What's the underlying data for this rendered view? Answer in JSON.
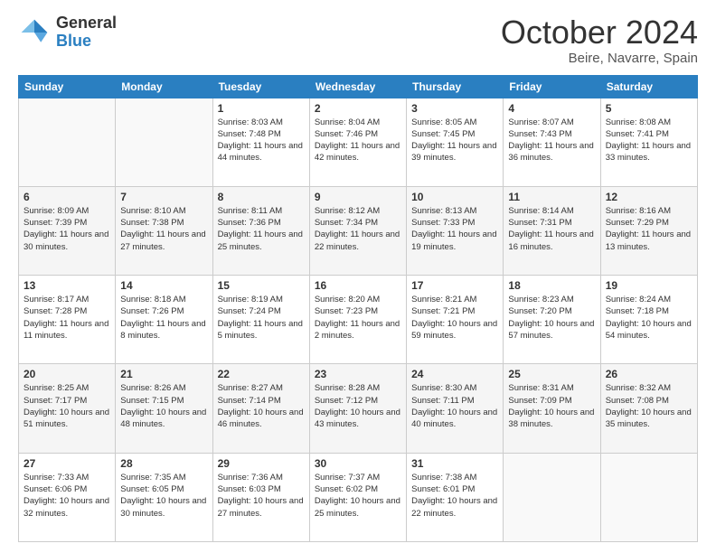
{
  "logo": {
    "general": "General",
    "blue": "Blue"
  },
  "header": {
    "month": "October 2024",
    "location": "Beire, Navarre, Spain"
  },
  "weekdays": [
    "Sunday",
    "Monday",
    "Tuesday",
    "Wednesday",
    "Thursday",
    "Friday",
    "Saturday"
  ],
  "weeks": [
    [
      {
        "date": "",
        "sunrise": "",
        "sunset": "",
        "daylight": ""
      },
      {
        "date": "",
        "sunrise": "",
        "sunset": "",
        "daylight": ""
      },
      {
        "date": "1",
        "sunrise": "Sunrise: 8:03 AM",
        "sunset": "Sunset: 7:48 PM",
        "daylight": "Daylight: 11 hours and 44 minutes."
      },
      {
        "date": "2",
        "sunrise": "Sunrise: 8:04 AM",
        "sunset": "Sunset: 7:46 PM",
        "daylight": "Daylight: 11 hours and 42 minutes."
      },
      {
        "date": "3",
        "sunrise": "Sunrise: 8:05 AM",
        "sunset": "Sunset: 7:45 PM",
        "daylight": "Daylight: 11 hours and 39 minutes."
      },
      {
        "date": "4",
        "sunrise": "Sunrise: 8:07 AM",
        "sunset": "Sunset: 7:43 PM",
        "daylight": "Daylight: 11 hours and 36 minutes."
      },
      {
        "date": "5",
        "sunrise": "Sunrise: 8:08 AM",
        "sunset": "Sunset: 7:41 PM",
        "daylight": "Daylight: 11 hours and 33 minutes."
      }
    ],
    [
      {
        "date": "6",
        "sunrise": "Sunrise: 8:09 AM",
        "sunset": "Sunset: 7:39 PM",
        "daylight": "Daylight: 11 hours and 30 minutes."
      },
      {
        "date": "7",
        "sunrise": "Sunrise: 8:10 AM",
        "sunset": "Sunset: 7:38 PM",
        "daylight": "Daylight: 11 hours and 27 minutes."
      },
      {
        "date": "8",
        "sunrise": "Sunrise: 8:11 AM",
        "sunset": "Sunset: 7:36 PM",
        "daylight": "Daylight: 11 hours and 25 minutes."
      },
      {
        "date": "9",
        "sunrise": "Sunrise: 8:12 AM",
        "sunset": "Sunset: 7:34 PM",
        "daylight": "Daylight: 11 hours and 22 minutes."
      },
      {
        "date": "10",
        "sunrise": "Sunrise: 8:13 AM",
        "sunset": "Sunset: 7:33 PM",
        "daylight": "Daylight: 11 hours and 19 minutes."
      },
      {
        "date": "11",
        "sunrise": "Sunrise: 8:14 AM",
        "sunset": "Sunset: 7:31 PM",
        "daylight": "Daylight: 11 hours and 16 minutes."
      },
      {
        "date": "12",
        "sunrise": "Sunrise: 8:16 AM",
        "sunset": "Sunset: 7:29 PM",
        "daylight": "Daylight: 11 hours and 13 minutes."
      }
    ],
    [
      {
        "date": "13",
        "sunrise": "Sunrise: 8:17 AM",
        "sunset": "Sunset: 7:28 PM",
        "daylight": "Daylight: 11 hours and 11 minutes."
      },
      {
        "date": "14",
        "sunrise": "Sunrise: 8:18 AM",
        "sunset": "Sunset: 7:26 PM",
        "daylight": "Daylight: 11 hours and 8 minutes."
      },
      {
        "date": "15",
        "sunrise": "Sunrise: 8:19 AM",
        "sunset": "Sunset: 7:24 PM",
        "daylight": "Daylight: 11 hours and 5 minutes."
      },
      {
        "date": "16",
        "sunrise": "Sunrise: 8:20 AM",
        "sunset": "Sunset: 7:23 PM",
        "daylight": "Daylight: 11 hours and 2 minutes."
      },
      {
        "date": "17",
        "sunrise": "Sunrise: 8:21 AM",
        "sunset": "Sunset: 7:21 PM",
        "daylight": "Daylight: 10 hours and 59 minutes."
      },
      {
        "date": "18",
        "sunrise": "Sunrise: 8:23 AM",
        "sunset": "Sunset: 7:20 PM",
        "daylight": "Daylight: 10 hours and 57 minutes."
      },
      {
        "date": "19",
        "sunrise": "Sunrise: 8:24 AM",
        "sunset": "Sunset: 7:18 PM",
        "daylight": "Daylight: 10 hours and 54 minutes."
      }
    ],
    [
      {
        "date": "20",
        "sunrise": "Sunrise: 8:25 AM",
        "sunset": "Sunset: 7:17 PM",
        "daylight": "Daylight: 10 hours and 51 minutes."
      },
      {
        "date": "21",
        "sunrise": "Sunrise: 8:26 AM",
        "sunset": "Sunset: 7:15 PM",
        "daylight": "Daylight: 10 hours and 48 minutes."
      },
      {
        "date": "22",
        "sunrise": "Sunrise: 8:27 AM",
        "sunset": "Sunset: 7:14 PM",
        "daylight": "Daylight: 10 hours and 46 minutes."
      },
      {
        "date": "23",
        "sunrise": "Sunrise: 8:28 AM",
        "sunset": "Sunset: 7:12 PM",
        "daylight": "Daylight: 10 hours and 43 minutes."
      },
      {
        "date": "24",
        "sunrise": "Sunrise: 8:30 AM",
        "sunset": "Sunset: 7:11 PM",
        "daylight": "Daylight: 10 hours and 40 minutes."
      },
      {
        "date": "25",
        "sunrise": "Sunrise: 8:31 AM",
        "sunset": "Sunset: 7:09 PM",
        "daylight": "Daylight: 10 hours and 38 minutes."
      },
      {
        "date": "26",
        "sunrise": "Sunrise: 8:32 AM",
        "sunset": "Sunset: 7:08 PM",
        "daylight": "Daylight: 10 hours and 35 minutes."
      }
    ],
    [
      {
        "date": "27",
        "sunrise": "Sunrise: 7:33 AM",
        "sunset": "Sunset: 6:06 PM",
        "daylight": "Daylight: 10 hours and 32 minutes."
      },
      {
        "date": "28",
        "sunrise": "Sunrise: 7:35 AM",
        "sunset": "Sunset: 6:05 PM",
        "daylight": "Daylight: 10 hours and 30 minutes."
      },
      {
        "date": "29",
        "sunrise": "Sunrise: 7:36 AM",
        "sunset": "Sunset: 6:03 PM",
        "daylight": "Daylight: 10 hours and 27 minutes."
      },
      {
        "date": "30",
        "sunrise": "Sunrise: 7:37 AM",
        "sunset": "Sunset: 6:02 PM",
        "daylight": "Daylight: 10 hours and 25 minutes."
      },
      {
        "date": "31",
        "sunrise": "Sunrise: 7:38 AM",
        "sunset": "Sunset: 6:01 PM",
        "daylight": "Daylight: 10 hours and 22 minutes."
      },
      {
        "date": "",
        "sunrise": "",
        "sunset": "",
        "daylight": ""
      },
      {
        "date": "",
        "sunrise": "",
        "sunset": "",
        "daylight": ""
      }
    ]
  ]
}
